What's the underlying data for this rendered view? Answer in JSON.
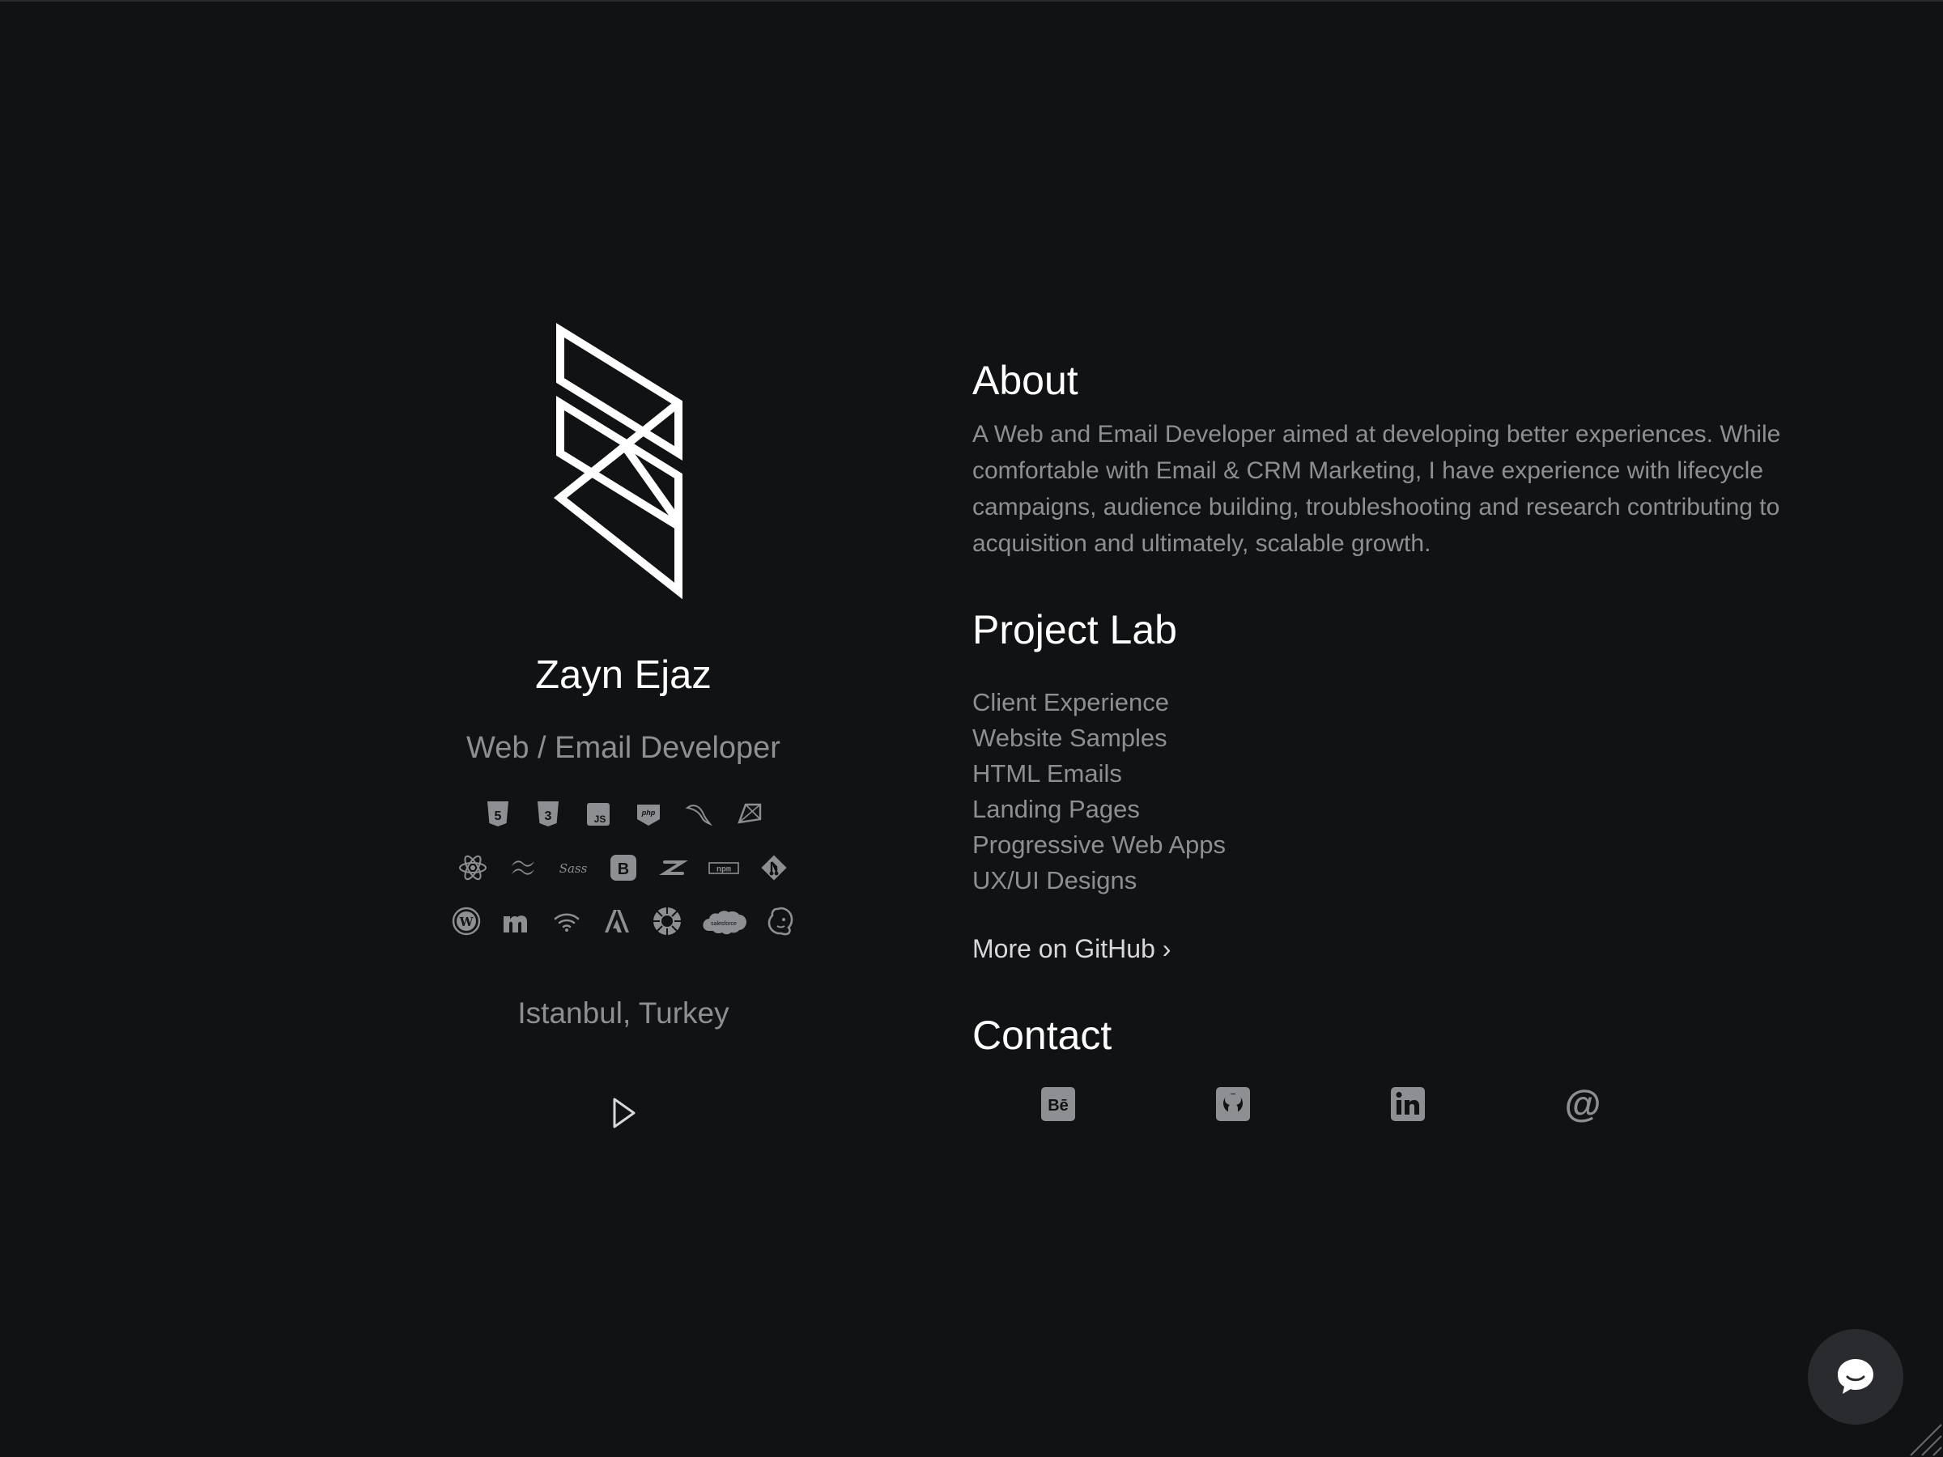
{
  "profile": {
    "name": "Zayn Ejaz",
    "role": "Web / Email Developer",
    "location": "Istanbul, Turkey",
    "tech_icons": [
      [
        "html5-icon",
        "css3-icon",
        "javascript-icon",
        "php-icon",
        "mysql-icon",
        "ruby-icon"
      ],
      [
        "react-icon",
        "tailwind-icon",
        "sass-icon",
        "bootstrap-icon",
        "zeplin-icon",
        "npm-icon",
        "git-icon"
      ],
      [
        "wordpress-icon",
        "mailmunch-icon",
        "wifi-icon",
        "adobe-icon",
        "circle-gear-icon",
        "salesforce-icon",
        "mailchimp-icon"
      ]
    ],
    "play_icon": "play-icon"
  },
  "about": {
    "title": "About",
    "text": "A Web and Email Developer aimed at developing better experiences. While comfortable with Email & CRM Marketing, I have experience with lifecycle campaigns, audience building, troubleshooting and research contributing to acquisition and ultimately, scalable growth."
  },
  "projects": {
    "title": "Project Lab",
    "items": [
      "Client Experience",
      "Website Samples",
      "HTML Emails",
      "Landing Pages",
      "Progressive Web Apps",
      "UX/UI Designs"
    ],
    "github_label": "More on GitHub ›"
  },
  "contact": {
    "title": "Contact",
    "icons": [
      "behance-icon",
      "github-icon",
      "linkedin-icon",
      "at-sign-icon"
    ]
  },
  "colors": {
    "background": "#111214",
    "heading": "#ffffff",
    "muted": "#8e8f93",
    "chat_bubble": "#2a2b2e"
  }
}
